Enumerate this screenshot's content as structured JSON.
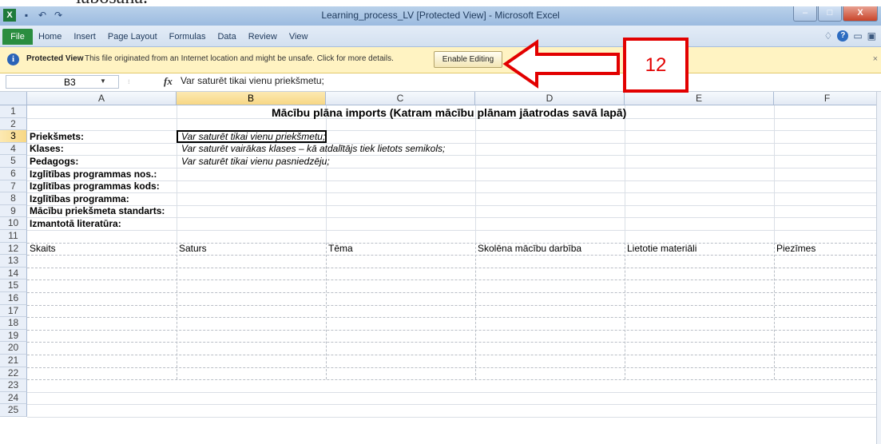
{
  "window": {
    "title": "Learning_process_LV  [Protected View]  -  Microsoft Excel",
    "controls": {
      "minimize": "–",
      "maximize": "□",
      "close": "X"
    }
  },
  "ribbon": {
    "file": "File",
    "tabs": [
      "Home",
      "Insert",
      "Page Layout",
      "Formulas",
      "Data",
      "Review",
      "View"
    ]
  },
  "protected_view": {
    "title": "Protected View",
    "message": "This file originated from an Internet location and might be unsafe. Click for more details.",
    "button": "Enable Editing"
  },
  "annotation": {
    "number": "12",
    "color": "#e20000"
  },
  "formula_bar": {
    "name_box": "B3",
    "fx": "fx",
    "content": "Var saturēt tikai vienu priekšmetu;"
  },
  "sheet": {
    "columns": [
      "A",
      "B",
      "C",
      "D",
      "E",
      "F"
    ],
    "selected_column": "B",
    "selected_row": "3",
    "rows": [
      "1",
      "2",
      "3",
      "4",
      "5",
      "6",
      "7",
      "8",
      "9",
      "10",
      "11",
      "12",
      "13",
      "14",
      "15",
      "16",
      "17",
      "18",
      "19",
      "20",
      "21",
      "22",
      "23",
      "24",
      "25"
    ],
    "title": "Mācību plāna imports (Katram mācību plānam jāatrodas savā lapā)",
    "labels": [
      "Priekšmets:",
      "Klases:",
      "Pedagogs:",
      "Izglītības programmas nos.:",
      "Izglītības programmas kods:",
      "Izglītības programma:",
      "Mācību priekšmeta standarts:",
      "Izmantotā literatūra:"
    ],
    "notes": [
      "Var saturēt tikai vienu priekšmetu;",
      "Var saturēt vairākas klases – kā atdalītājs tiek lietots semikols;",
      "Var saturēt tikai vienu pasniedzēju;"
    ],
    "table_headers": [
      "Skaits",
      "Saturs",
      "Tēma",
      "Skolēna mācību darbība",
      "Lietotie materiāli",
      "Piezīmes"
    ]
  }
}
